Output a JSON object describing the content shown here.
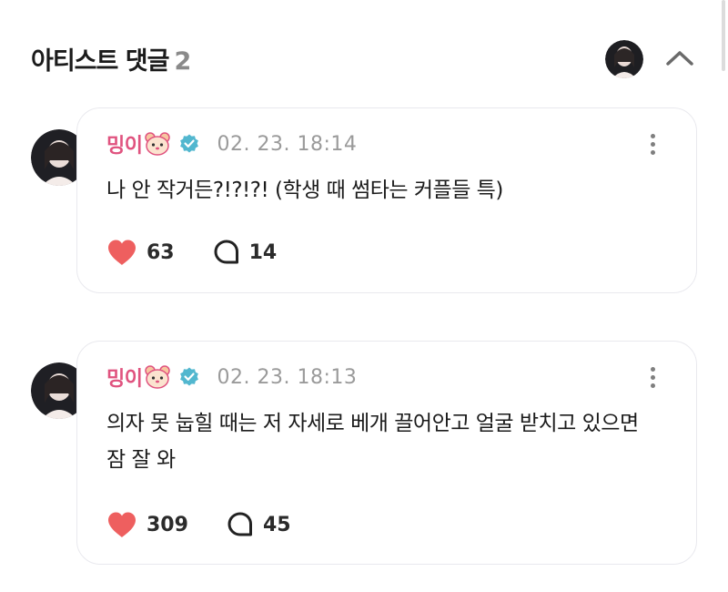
{
  "header": {
    "title": "아티스트 댓글",
    "count": "2"
  },
  "comments": [
    {
      "author": "밍이",
      "emoji_icon": "hamster-face-icon",
      "verified_icon": "verified-badge-icon",
      "timestamp": "02. 23. 18:14",
      "text": "나 안 작거든?!?!?! (학생 때 썸타는 커플들 특)",
      "likes": "63",
      "replies": "14"
    },
    {
      "author": "밍이",
      "emoji_icon": "hamster-face-icon",
      "verified_icon": "verified-badge-icon",
      "timestamp": "02. 23. 18:13",
      "text": "의자 못 눕힐 때는 저 자세로 베개 끌어안고 얼굴 받치고 있으면 잠 잘 와",
      "likes": "309",
      "replies": "45"
    }
  ],
  "colors": {
    "author": "#e0537f",
    "heart": "#ee5f5f",
    "verified": "#52b7cf",
    "muted": "#9a9a9a",
    "card_border": "#e9e9ee"
  }
}
